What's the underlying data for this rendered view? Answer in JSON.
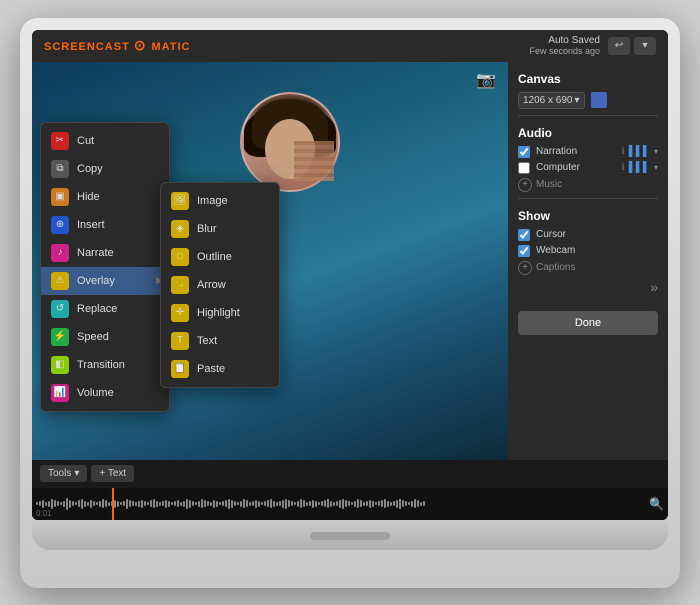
{
  "app": {
    "name": "SCREENCAST",
    "brand": "O",
    "name2": "MATIC",
    "auto_saved": "Auto Saved",
    "auto_saved_time": "Few seconds ago"
  },
  "canvas": {
    "title": "Canvas",
    "resolution": "1206 x 690",
    "dropdown_icon": "▾"
  },
  "audio": {
    "title": "Audio",
    "narration_label": "Narration",
    "computer_label": "Computer",
    "music_label": "Music"
  },
  "show": {
    "title": "Show",
    "cursor_label": "Cursor",
    "webcam_label": "Webcam",
    "captions_label": "Captions"
  },
  "done_button": "Done",
  "toolbar": {
    "tools_label": "Tools",
    "text_label": "+ Text"
  },
  "context_menu": {
    "items": [
      {
        "id": "cut",
        "label": "Cut",
        "icon_color": "icon-red",
        "icon_char": "✂"
      },
      {
        "id": "copy",
        "label": "Copy",
        "icon_color": "icon-gray",
        "icon_char": "⧉"
      },
      {
        "id": "hide",
        "label": "Hide",
        "icon_color": "icon-orange",
        "icon_char": "◱"
      },
      {
        "id": "insert",
        "label": "Insert",
        "icon_color": "icon-blue",
        "icon_char": "⊕"
      },
      {
        "id": "narrate",
        "label": "Narrate",
        "icon_color": "icon-pink",
        "icon_char": "🎙"
      },
      {
        "id": "overlay",
        "label": "Overlay",
        "icon_color": "icon-yellow",
        "has_submenu": true,
        "icon_char": "⚠"
      },
      {
        "id": "replace",
        "label": "Replace",
        "icon_color": "icon-teal",
        "icon_char": "↺"
      },
      {
        "id": "speed",
        "label": "Speed",
        "icon_color": "icon-green",
        "icon_char": "⚡"
      },
      {
        "id": "transition",
        "label": "Transition",
        "icon_color": "icon-lime",
        "icon_char": "◧"
      },
      {
        "id": "volume",
        "label": "Volume",
        "icon_color": "icon-pink",
        "icon_char": "📊"
      }
    ]
  },
  "submenu": {
    "items": [
      {
        "id": "image",
        "label": "Image",
        "icon_color": "icon-yellow",
        "icon_char": "🖼"
      },
      {
        "id": "blur",
        "label": "Blur",
        "icon_color": "icon-yellow",
        "icon_char": "◈"
      },
      {
        "id": "outline",
        "label": "Outline",
        "icon_color": "icon-yellow",
        "icon_char": "□"
      },
      {
        "id": "arrow",
        "label": "Arrow",
        "icon_color": "icon-yellow",
        "icon_char": "→"
      },
      {
        "id": "highlight",
        "label": "Highlight",
        "icon_color": "icon-yellow",
        "icon_char": "+"
      },
      {
        "id": "text",
        "label": "Text",
        "icon_color": "icon-yellow",
        "icon_char": "T"
      },
      {
        "id": "paste",
        "label": "Paste",
        "icon_color": "icon-yellow",
        "icon_char": "📋"
      }
    ]
  }
}
